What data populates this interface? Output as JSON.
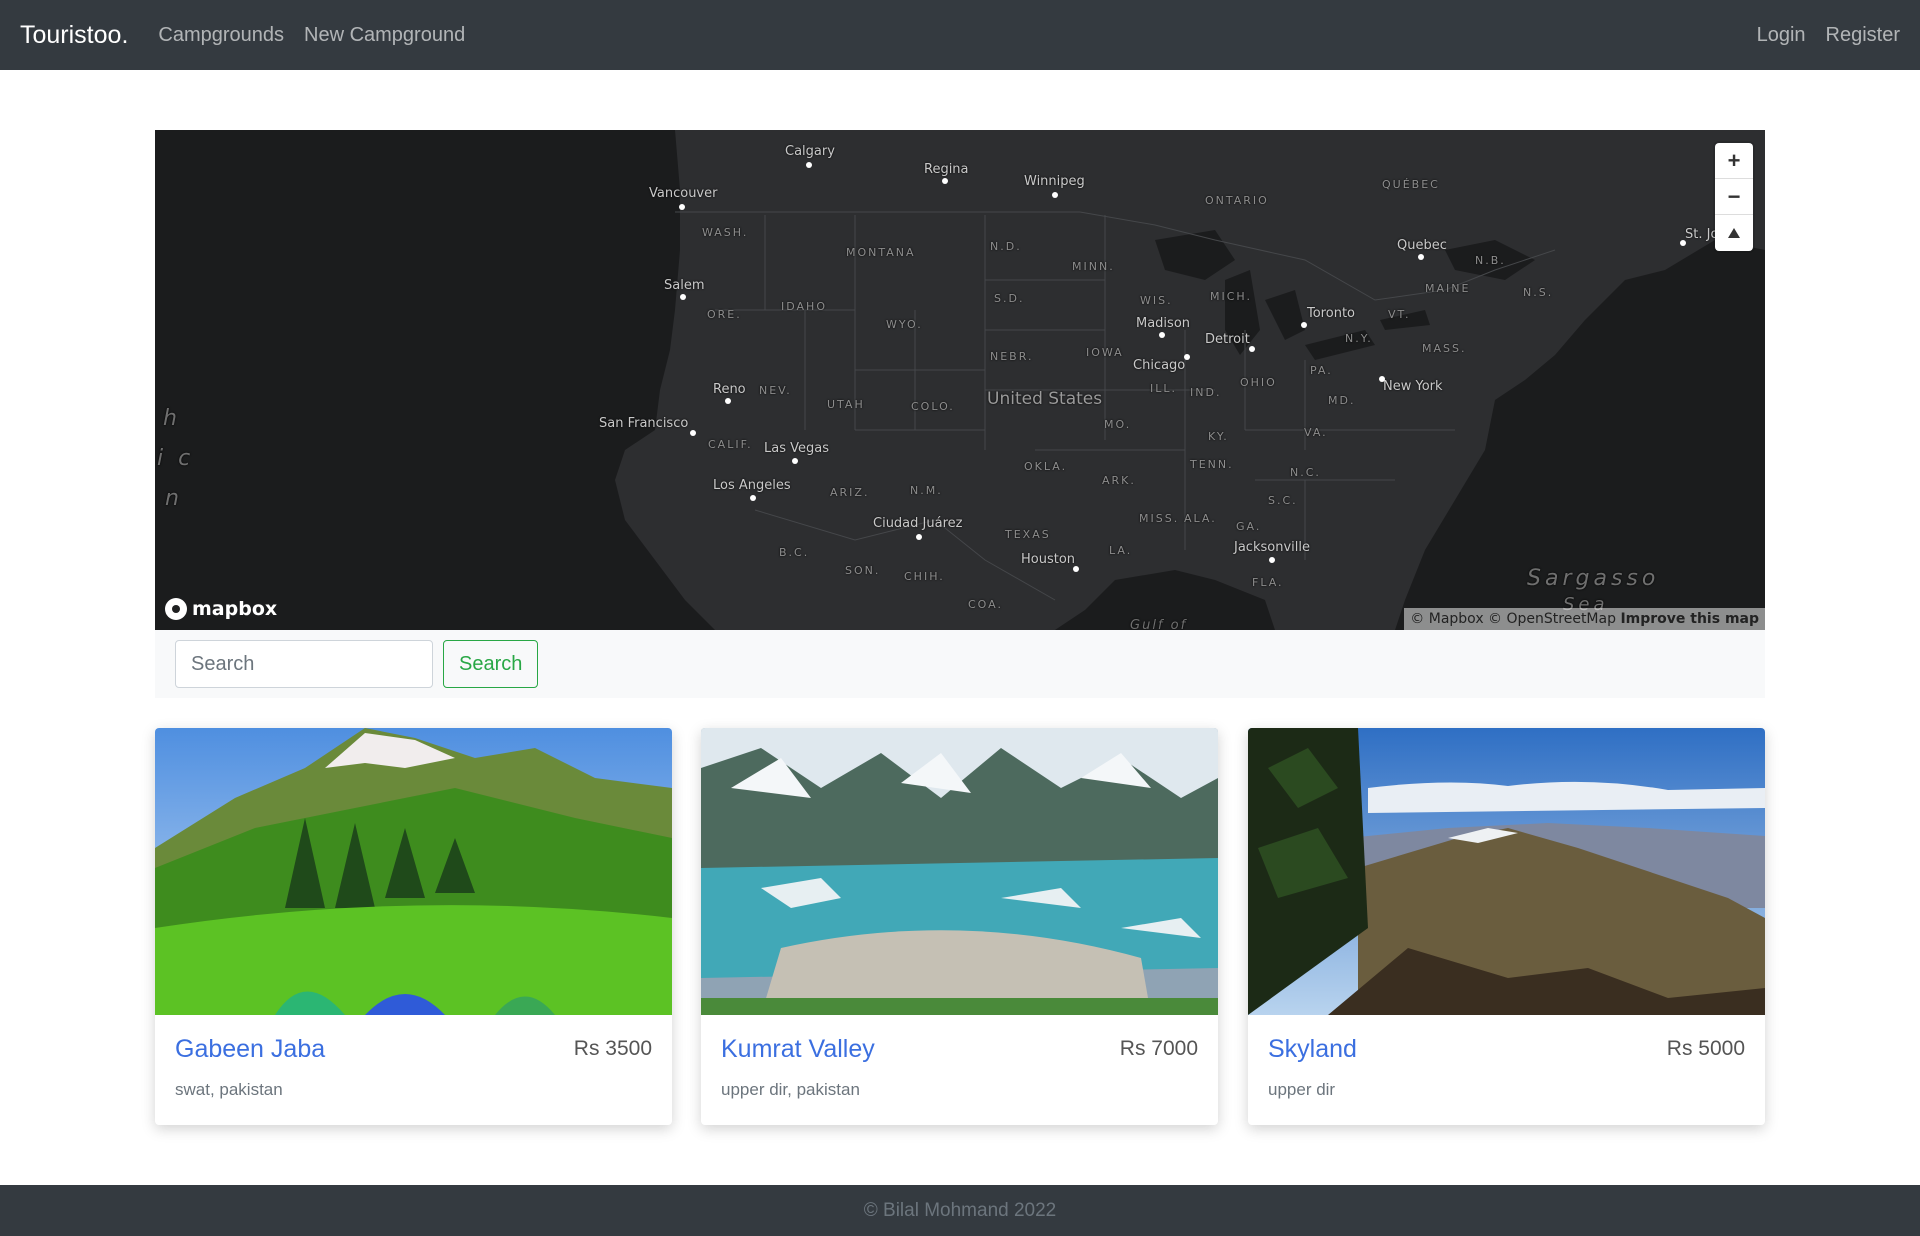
{
  "nav": {
    "brand": "Touristoo.",
    "links": [
      "Campgrounds",
      "New Campground"
    ],
    "login": "Login",
    "register": "Register"
  },
  "map": {
    "cities": [
      "Calgary",
      "Regina",
      "Winnipeg",
      "Vancouver",
      "Salem",
      "Reno",
      "San Francisco",
      "Las Vegas",
      "Los Angeles",
      "Ciudad Juárez",
      "Houston",
      "Madison",
      "Chicago",
      "Detroit",
      "Toronto",
      "Quebec",
      "New York",
      "Jacksonville",
      "St. Jo"
    ],
    "regions": [
      "ONTARIO",
      "QUÉBEC",
      "WASH.",
      "MONTANA",
      "N.D.",
      "MINN.",
      "S.D.",
      "WIS.",
      "MICH.",
      "ORE.",
      "IDAHO",
      "WYO.",
      "NEBR.",
      "IOWA",
      "ILL.",
      "IND.",
      "OHIO",
      "PA.",
      "N.Y.",
      "VT.",
      "MAINE",
      "N.B.",
      "N.S.",
      "MASS.",
      "NEV.",
      "UTAH",
      "COLO.",
      "MO.",
      "KY.",
      "VA.",
      "MD.",
      "CALIF.",
      "ARIZ.",
      "N.M.",
      "OKLA.",
      "ARK.",
      "TENN.",
      "N.C.",
      "S.C.",
      "MISS.",
      "ALA.",
      "GA.",
      "TEXAS",
      "LA.",
      "FLA.",
      "B.C.",
      "SON.",
      "CHIH.",
      "COA."
    ],
    "country": "United States",
    "oceans": [
      "Sargasso",
      "Sea",
      "h",
      "i c",
      "n",
      "Gulf of"
    ],
    "zoom_in": "+",
    "zoom_out": "−",
    "logo": "mapbox",
    "attribution": "© Mapbox © OpenStreetMap",
    "improve": "Improve this map"
  },
  "search": {
    "placeholder": "Search",
    "button": "Search"
  },
  "campgrounds": [
    {
      "title": "Gabeen Jaba",
      "price": "Rs 3500",
      "location": "swat, pakistan"
    },
    {
      "title": "Kumrat Valley",
      "price": "Rs 7000",
      "location": "upper dir, pakistan"
    },
    {
      "title": "Skyland",
      "price": "Rs 5000",
      "location": "upper dir"
    }
  ],
  "footer": {
    "text": "© Bilal Mohmand 2022"
  }
}
